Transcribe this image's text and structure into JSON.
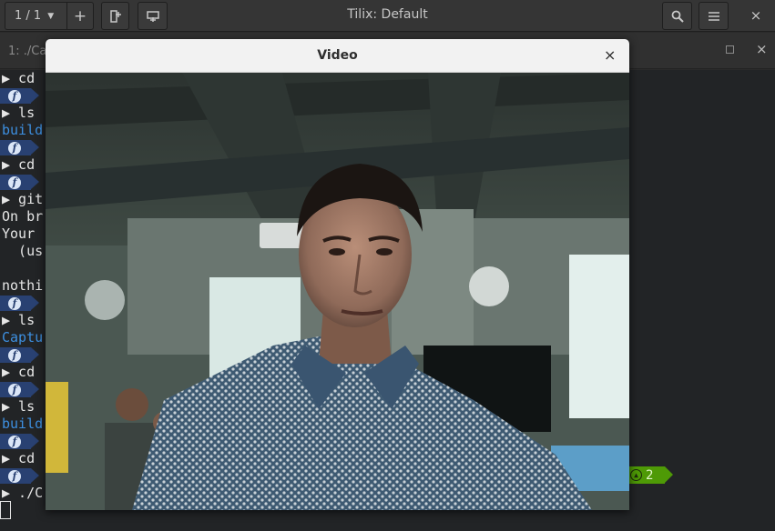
{
  "app": {
    "title": "Tilix: Default",
    "session_label": "1 / 1",
    "add_label": "+",
    "close_label": "×"
  },
  "terminal": {
    "title": "1: ./Ca",
    "close_label": "×",
    "lines": [
      "▶ cd",
      "▶ ls",
      "build",
      "▶ cd",
      "▶ git",
      "On br",
      "Your",
      "  (us",
      "nothi",
      "▶ ls",
      "Captu",
      "▶ cd",
      "▶ ls",
      "build",
      "▶ cd",
      "▶ ./C"
    ],
    "git_count": "2"
  },
  "video": {
    "title": "Video",
    "close_label": "×"
  },
  "colors": {
    "fedora_blue": "#294172",
    "git_green": "#4e9a06",
    "link_blue": "#3d8fe0"
  }
}
